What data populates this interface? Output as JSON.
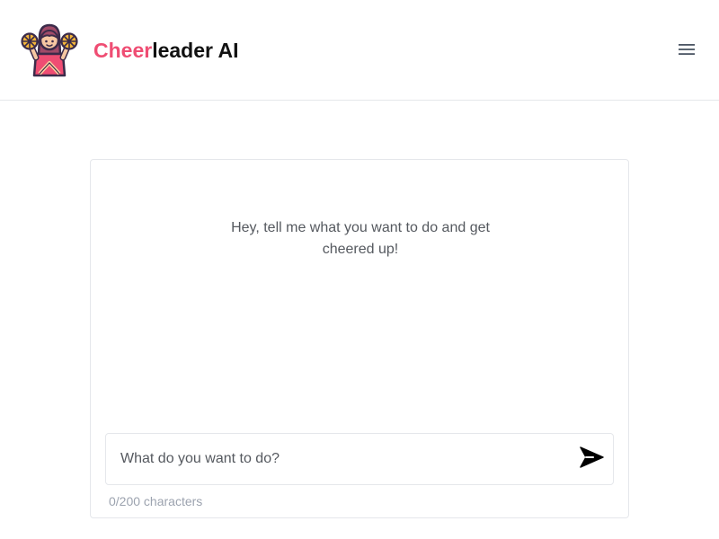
{
  "header": {
    "brand_accent": "Cheer",
    "brand_rest": "leader AI",
    "logo_icon": "cheerleader-icon",
    "menu_icon": "hamburger-menu-icon"
  },
  "chat": {
    "greeting_line1": "Hey, tell me what you want to do and get",
    "greeting_line2": "cheered up!"
  },
  "composer": {
    "placeholder": "What do you want to do?",
    "value": "",
    "send_icon": "send-icon",
    "counter": "0/200 characters"
  },
  "colors": {
    "accent": "#ef4d73",
    "text_dark": "#111111",
    "text_muted": "#55595f",
    "counter": "#9ca3af",
    "border": "#e5e7eb"
  }
}
